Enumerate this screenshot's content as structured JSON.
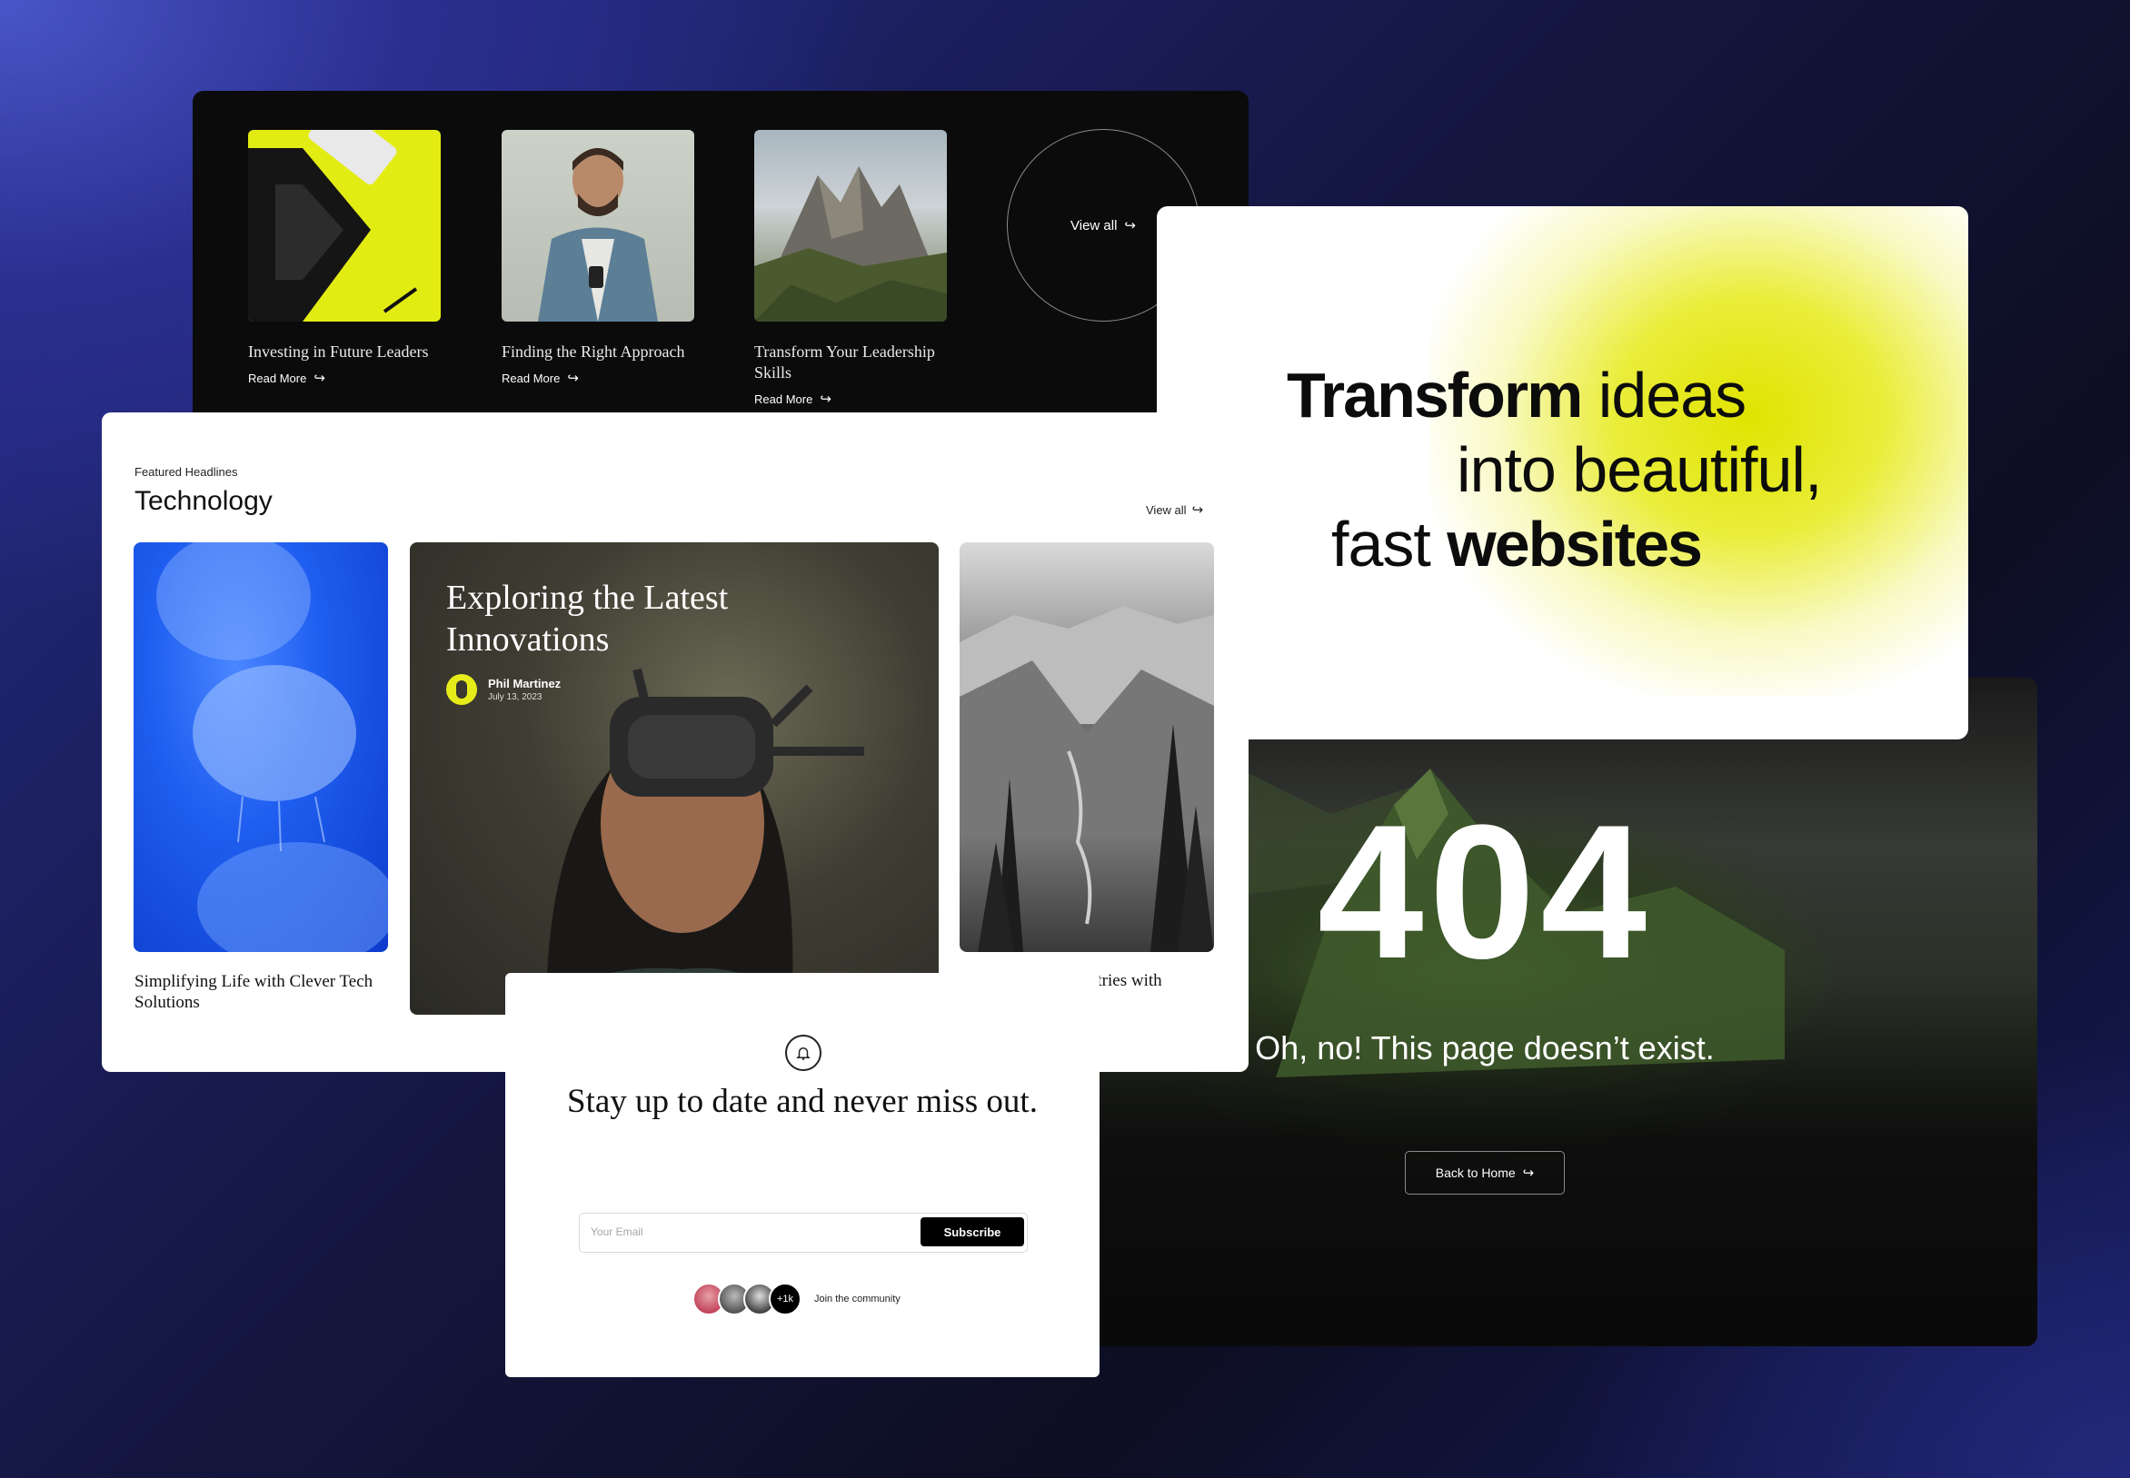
{
  "articles_panel": {
    "items": [
      {
        "title": "Investing in Future Leaders",
        "link": "Read More"
      },
      {
        "title": "Finding the Right Approach",
        "link": "Read More"
      },
      {
        "title": "Transform Your Leadership Skills",
        "link": "Read More"
      }
    ],
    "view_all": "View all"
  },
  "featured": {
    "eyebrow": "Featured Headlines",
    "title": "Technology",
    "view_all": "View all",
    "left_caption": "Simplifying Life with Clever Tech Solutions",
    "main_title": "Exploring the Latest Innovations",
    "author_name": "Phil Martinez",
    "author_date": "July 13, 2023",
    "right_caption": "stries with"
  },
  "hero": {
    "line1_bold": "Transform",
    "line1_light": " ideas",
    "line2": "into beautiful,",
    "line3_light": "fast ",
    "line3_bold": "websites",
    "accent": "#e0e400"
  },
  "not_found": {
    "code": "404",
    "message": "Oh, no! This page doesn’t exist.",
    "back_button": "Back to Home"
  },
  "newsletter": {
    "title": "Stay up to date and never miss out.",
    "email_placeholder": "Your Email",
    "subscribe": "Subscribe",
    "member_count": "+1k",
    "join_text": "Join the community"
  }
}
